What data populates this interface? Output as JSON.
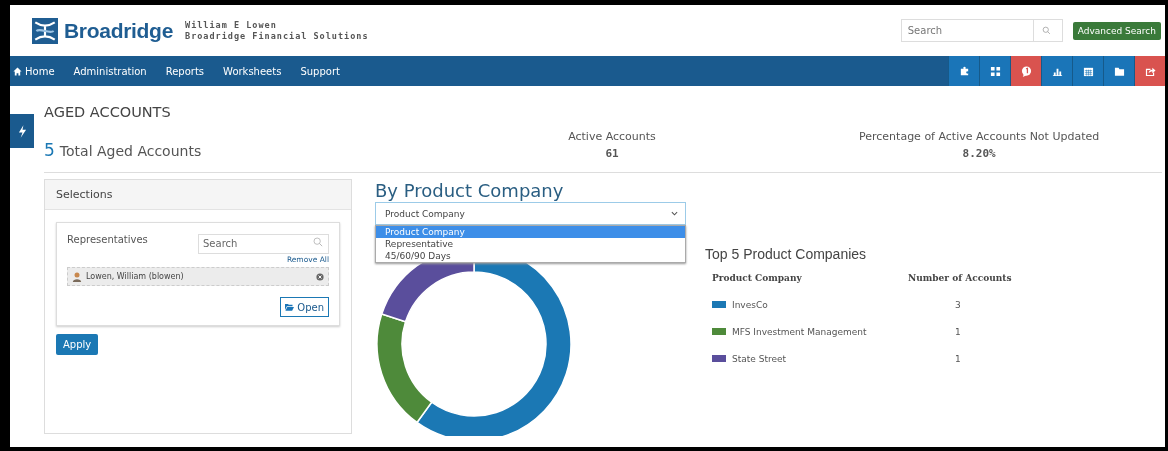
{
  "header": {
    "brand": "Broadridge",
    "user_name": "William E Lowen",
    "company": "Broadridge Financial Solutions",
    "search": {
      "placeholder": "Search"
    },
    "advanced_search": "Advanced Search"
  },
  "nav": {
    "items": [
      {
        "label": "Home",
        "kind": "home"
      },
      {
        "label": "Administration",
        "kind": "link"
      },
      {
        "label": "Reports",
        "kind": "link"
      },
      {
        "label": "Worksheets",
        "kind": "link"
      },
      {
        "label": "Support",
        "kind": "link"
      }
    ],
    "toolbar_icons": [
      {
        "kind": "puzzle",
        "color": "#1a75b8"
      },
      {
        "kind": "grid",
        "color": "#1a75b8"
      },
      {
        "kind": "chat",
        "color": "#d9534f"
      },
      {
        "kind": "bars",
        "color": "#1a75b8"
      },
      {
        "kind": "calendar",
        "color": "#1a75b8"
      },
      {
        "kind": "folder",
        "color": "#1a75b8"
      },
      {
        "kind": "share",
        "color": "#d9534f"
      }
    ]
  },
  "page_title": "AGED ACCOUNTS",
  "summary": {
    "total_count": "5",
    "total_label": "Total Aged Accounts",
    "stats": [
      {
        "label": "Active Accounts",
        "value": "61"
      },
      {
        "label": "Percentage of Active Accounts Not Updated",
        "value": "8.20%"
      }
    ]
  },
  "selections": {
    "title": "Selections",
    "representatives_label": "Representatives",
    "search": {
      "placeholder": "Search"
    },
    "remove_all": "Remove All",
    "chips": [
      {
        "label": "Lowen, William (blowen)"
      }
    ],
    "open_button": "Open",
    "apply_button": "Apply"
  },
  "chart_panel": {
    "title": "By Product Company",
    "dropdown": {
      "value": "Product Company",
      "options": [
        {
          "label": "Product Company",
          "selected": true
        },
        {
          "label": "Representative",
          "selected": false
        },
        {
          "label": "45/60/90 Days",
          "selected": false
        }
      ]
    },
    "legend_title": "Top 5 Product Companies",
    "category_column": "Product Company",
    "legend_counts": [
      {
        "count": "3"
      },
      {
        "count": "1"
      },
      {
        "count": "1"
      }
    ],
    "chart_data": {
      "type": "donut",
      "categories": [
        "InvesCo",
        "MFS Investment Management",
        "State Street"
      ],
      "series": [
        {
          "name": "Number of Accounts",
          "values": [
            60,
            20,
            20
          ]
        }
      ],
      "colors": [
        "#1b78b4",
        "#4e8a3a",
        "#5a4e9c"
      ]
    }
  }
}
